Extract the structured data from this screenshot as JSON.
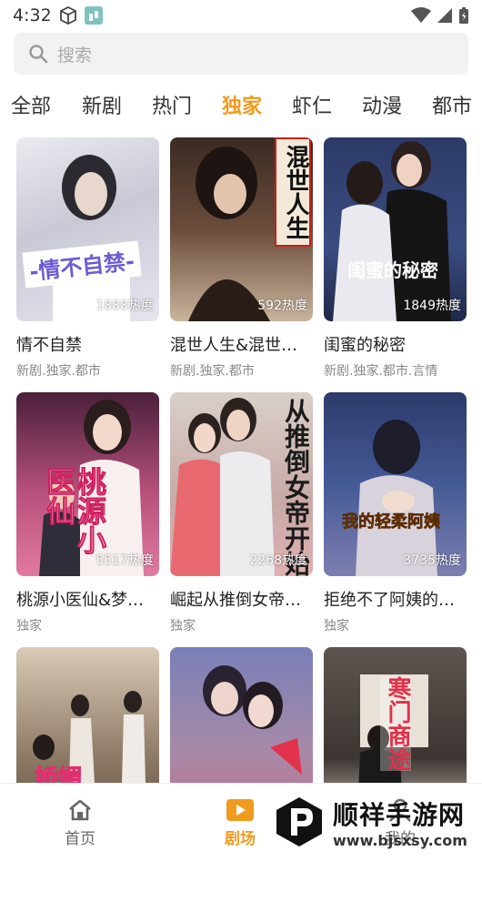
{
  "status_bar": {
    "time": "4:32"
  },
  "search": {
    "placeholder": "搜索"
  },
  "tabs": [
    {
      "label": "全部"
    },
    {
      "label": "新剧"
    },
    {
      "label": "热门"
    },
    {
      "label": "独家",
      "active": true
    },
    {
      "label": "虾仁"
    },
    {
      "label": "动漫"
    },
    {
      "label": "都市"
    }
  ],
  "cards": [
    {
      "title": "情不自禁",
      "tags": "新剧.独家.都市",
      "heat": "1888热度",
      "cover_text": "-情不自禁-"
    },
    {
      "title": "混世人生&混世…",
      "tags": "新剧.独家.都市",
      "heat": "592热度",
      "cover_text": "混世人生"
    },
    {
      "title": "闺蜜的秘密",
      "tags": "新剧.独家.都市.言情",
      "heat": "1849热度",
      "cover_text": "闺蜜的秘密"
    },
    {
      "title": "桃源小医仙&梦…",
      "tags": "独家",
      "heat": "5517热度",
      "cover_text": "桃源小医仙"
    },
    {
      "title": "崛起从推倒女帝…",
      "tags": "独家",
      "heat": "2268热度",
      "cover_text": "从推倒女帝开始"
    },
    {
      "title": "拒绝不了阿姨的…",
      "tags": "独家",
      "heat": "3735热度",
      "cover_text": "我的轻柔阿姨"
    },
    {
      "title": "",
      "tags": "",
      "heat": "",
      "cover_text": "娇媚"
    },
    {
      "title": "",
      "tags": "",
      "heat": "",
      "cover_text": ""
    },
    {
      "title": "",
      "tags": "",
      "heat": "",
      "cover_text": "寒门商途"
    }
  ],
  "bottom_nav": [
    {
      "label": "首页",
      "icon": "home-icon"
    },
    {
      "label": "剧场",
      "icon": "play-icon",
      "active": true
    },
    {
      "label": "我的",
      "icon": "user-icon"
    }
  ],
  "watermark": {
    "name": "顺祥手游网",
    "url": "www.bjsxsy.com"
  },
  "colors": {
    "accent": "#f09a1e"
  }
}
